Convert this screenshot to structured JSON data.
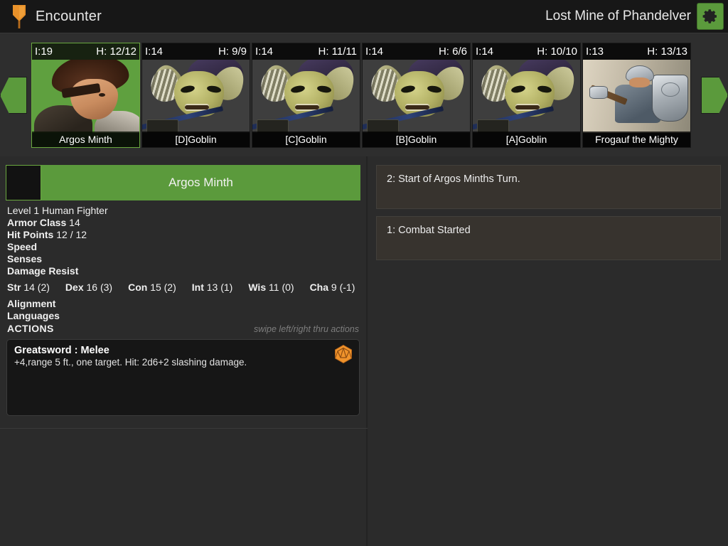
{
  "header": {
    "icon": "shield-torch-icon",
    "title": "Encounter",
    "campaign": "Lost Mine of Phandelver",
    "settings_icon": "gear-icon",
    "accent_green": "#5b9a3c",
    "accent_orange": "#e8912a"
  },
  "initiative": {
    "prev_label": "prev-combatant-arrow",
    "next_label": "next-combatant-arrow",
    "combatants": [
      {
        "initiative": "I:19",
        "hp": "H: 12/12",
        "name": "Argos Minth",
        "art": "hero",
        "active": true
      },
      {
        "initiative": "I:14",
        "hp": "H: 9/9",
        "name": "[D]Goblin",
        "art": "goblin",
        "active": false
      },
      {
        "initiative": "I:14",
        "hp": "H: 11/11",
        "name": "[C]Goblin",
        "art": "goblin",
        "active": false
      },
      {
        "initiative": "I:14",
        "hp": "H: 6/6",
        "name": "[B]Goblin",
        "art": "goblin",
        "active": false
      },
      {
        "initiative": "I:14",
        "hp": "H: 10/10",
        "name": "[A]Goblin",
        "art": "goblin",
        "active": false
      },
      {
        "initiative": "I:13",
        "hp": "H: 13/13",
        "name": "Frogauf the Mighty",
        "art": "dwarf",
        "active": false
      }
    ]
  },
  "sheet": {
    "name": "Argos Minth",
    "subtitle": "Level 1 Human Fighter",
    "armor_class_label": "Armor Class",
    "armor_class_value": "14",
    "hit_points_label": "Hit Points",
    "hit_points_value": "12 / 12",
    "speed_label": "Speed",
    "speed_value": "",
    "senses_label": "Senses",
    "senses_value": "",
    "damage_resist_label": "Damage Resist",
    "damage_resist_value": "",
    "abilities": [
      {
        "label": "Str",
        "value": "14 (2)"
      },
      {
        "label": "Dex",
        "value": "16 (3)"
      },
      {
        "label": "Con",
        "value": "15 (2)"
      },
      {
        "label": "Int",
        "value": "13 (1)"
      },
      {
        "label": "Wis",
        "value": "11 (0)"
      },
      {
        "label": "Cha",
        "value": "9 (-1)"
      }
    ],
    "alignment_label": "Alignment",
    "alignment_value": "",
    "languages_label": "Languages",
    "languages_value": "",
    "actions_label": "ACTIONS",
    "swipe_hint": "swipe left/right thru actions",
    "action": {
      "title": "Greatsword : Melee",
      "description": "+4,range 5 ft., one target. Hit: 2d6+2 slashing damage.",
      "roll_icon": "d20-dice-icon"
    }
  },
  "log": {
    "entries": [
      "2: Start of Argos Minths Turn.",
      "1: Combat Started"
    ]
  }
}
